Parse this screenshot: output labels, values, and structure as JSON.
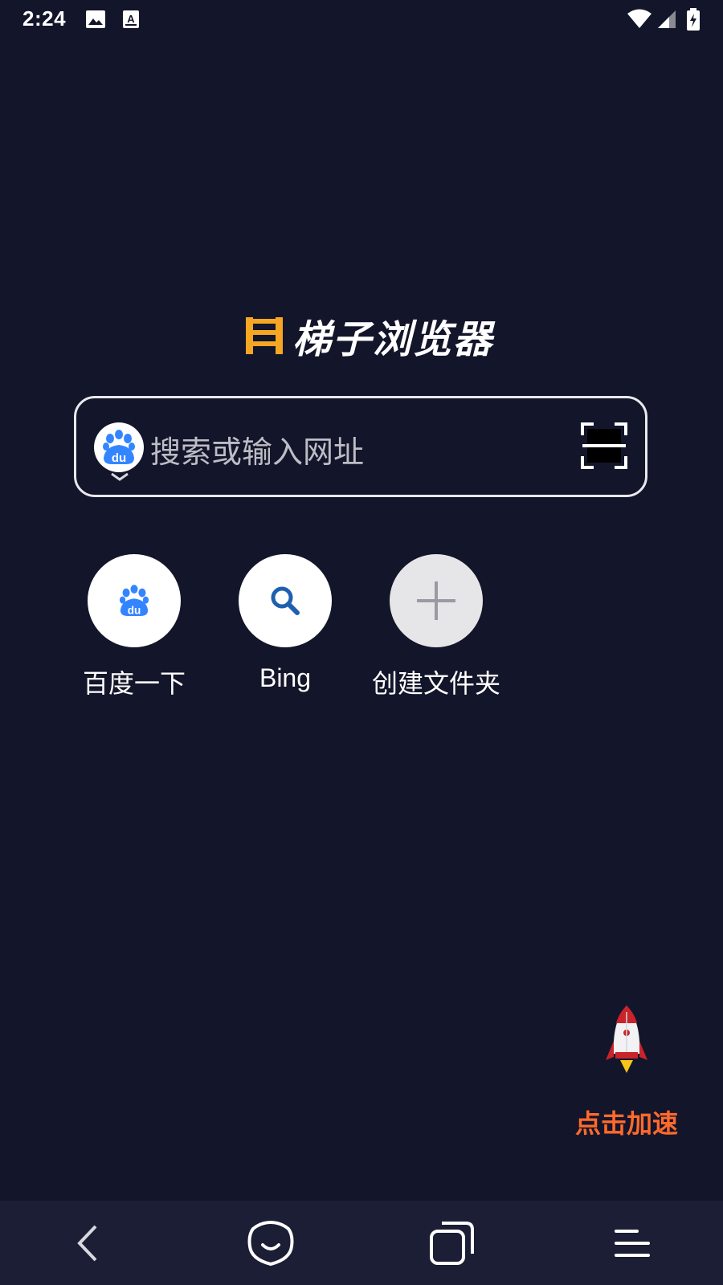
{
  "status_bar": {
    "time": "2:24",
    "icons": [
      "image-icon",
      "a-text-icon",
      "wifi-icon",
      "signal-icon",
      "battery-charging-icon"
    ]
  },
  "app": {
    "logo_text": "梯子浏览器",
    "accent_color": "#f5a623"
  },
  "search": {
    "engine_icon": "baidu-paw-icon",
    "placeholder": "搜索或输入网址",
    "scan_icon": "scan-icon"
  },
  "shortcuts": [
    {
      "label": "百度一下",
      "icon": "baidu-paw-icon"
    },
    {
      "label": "Bing",
      "icon": "search-icon"
    },
    {
      "label": "创建文件夹",
      "icon": "plus-icon"
    }
  ],
  "boost": {
    "label": "点击加速",
    "icon": "rocket-icon",
    "color": "#ff6a2c"
  },
  "nav": {
    "items": [
      "back-icon",
      "home-face-icon",
      "tabs-icon",
      "menu-icon"
    ]
  }
}
